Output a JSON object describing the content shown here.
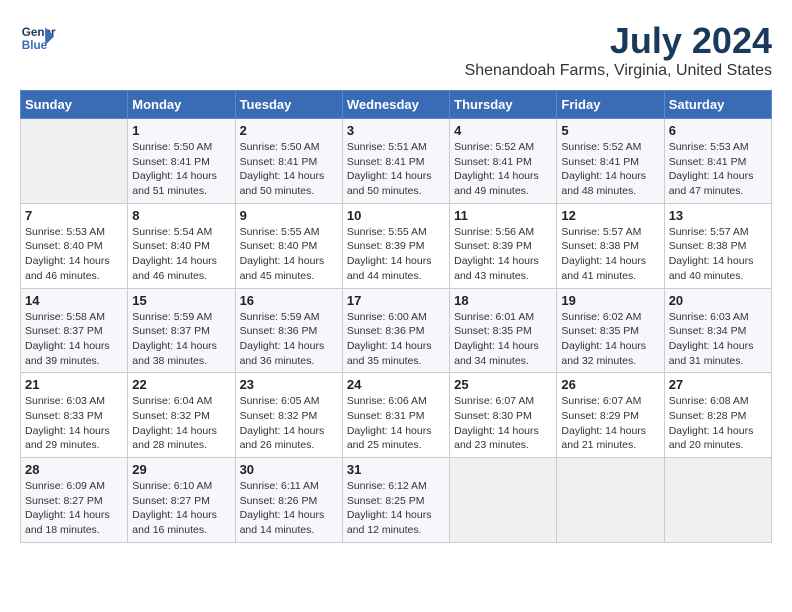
{
  "header": {
    "logo_line1": "General",
    "logo_line2": "Blue",
    "title": "July 2024",
    "subtitle": "Shenandoah Farms, Virginia, United States"
  },
  "weekdays": [
    "Sunday",
    "Monday",
    "Tuesday",
    "Wednesday",
    "Thursday",
    "Friday",
    "Saturday"
  ],
  "weeks": [
    [
      {
        "day": "",
        "info": ""
      },
      {
        "day": "1",
        "info": "Sunrise: 5:50 AM\nSunset: 8:41 PM\nDaylight: 14 hours\nand 51 minutes."
      },
      {
        "day": "2",
        "info": "Sunrise: 5:50 AM\nSunset: 8:41 PM\nDaylight: 14 hours\nand 50 minutes."
      },
      {
        "day": "3",
        "info": "Sunrise: 5:51 AM\nSunset: 8:41 PM\nDaylight: 14 hours\nand 50 minutes."
      },
      {
        "day": "4",
        "info": "Sunrise: 5:52 AM\nSunset: 8:41 PM\nDaylight: 14 hours\nand 49 minutes."
      },
      {
        "day": "5",
        "info": "Sunrise: 5:52 AM\nSunset: 8:41 PM\nDaylight: 14 hours\nand 48 minutes."
      },
      {
        "day": "6",
        "info": "Sunrise: 5:53 AM\nSunset: 8:41 PM\nDaylight: 14 hours\nand 47 minutes."
      }
    ],
    [
      {
        "day": "7",
        "info": "Sunrise: 5:53 AM\nSunset: 8:40 PM\nDaylight: 14 hours\nand 46 minutes."
      },
      {
        "day": "8",
        "info": "Sunrise: 5:54 AM\nSunset: 8:40 PM\nDaylight: 14 hours\nand 46 minutes."
      },
      {
        "day": "9",
        "info": "Sunrise: 5:55 AM\nSunset: 8:40 PM\nDaylight: 14 hours\nand 45 minutes."
      },
      {
        "day": "10",
        "info": "Sunrise: 5:55 AM\nSunset: 8:39 PM\nDaylight: 14 hours\nand 44 minutes."
      },
      {
        "day": "11",
        "info": "Sunrise: 5:56 AM\nSunset: 8:39 PM\nDaylight: 14 hours\nand 43 minutes."
      },
      {
        "day": "12",
        "info": "Sunrise: 5:57 AM\nSunset: 8:38 PM\nDaylight: 14 hours\nand 41 minutes."
      },
      {
        "day": "13",
        "info": "Sunrise: 5:57 AM\nSunset: 8:38 PM\nDaylight: 14 hours\nand 40 minutes."
      }
    ],
    [
      {
        "day": "14",
        "info": "Sunrise: 5:58 AM\nSunset: 8:37 PM\nDaylight: 14 hours\nand 39 minutes."
      },
      {
        "day": "15",
        "info": "Sunrise: 5:59 AM\nSunset: 8:37 PM\nDaylight: 14 hours\nand 38 minutes."
      },
      {
        "day": "16",
        "info": "Sunrise: 5:59 AM\nSunset: 8:36 PM\nDaylight: 14 hours\nand 36 minutes."
      },
      {
        "day": "17",
        "info": "Sunrise: 6:00 AM\nSunset: 8:36 PM\nDaylight: 14 hours\nand 35 minutes."
      },
      {
        "day": "18",
        "info": "Sunrise: 6:01 AM\nSunset: 8:35 PM\nDaylight: 14 hours\nand 34 minutes."
      },
      {
        "day": "19",
        "info": "Sunrise: 6:02 AM\nSunset: 8:35 PM\nDaylight: 14 hours\nand 32 minutes."
      },
      {
        "day": "20",
        "info": "Sunrise: 6:03 AM\nSunset: 8:34 PM\nDaylight: 14 hours\nand 31 minutes."
      }
    ],
    [
      {
        "day": "21",
        "info": "Sunrise: 6:03 AM\nSunset: 8:33 PM\nDaylight: 14 hours\nand 29 minutes."
      },
      {
        "day": "22",
        "info": "Sunrise: 6:04 AM\nSunset: 8:32 PM\nDaylight: 14 hours\nand 28 minutes."
      },
      {
        "day": "23",
        "info": "Sunrise: 6:05 AM\nSunset: 8:32 PM\nDaylight: 14 hours\nand 26 minutes."
      },
      {
        "day": "24",
        "info": "Sunrise: 6:06 AM\nSunset: 8:31 PM\nDaylight: 14 hours\nand 25 minutes."
      },
      {
        "day": "25",
        "info": "Sunrise: 6:07 AM\nSunset: 8:30 PM\nDaylight: 14 hours\nand 23 minutes."
      },
      {
        "day": "26",
        "info": "Sunrise: 6:07 AM\nSunset: 8:29 PM\nDaylight: 14 hours\nand 21 minutes."
      },
      {
        "day": "27",
        "info": "Sunrise: 6:08 AM\nSunset: 8:28 PM\nDaylight: 14 hours\nand 20 minutes."
      }
    ],
    [
      {
        "day": "28",
        "info": "Sunrise: 6:09 AM\nSunset: 8:27 PM\nDaylight: 14 hours\nand 18 minutes."
      },
      {
        "day": "29",
        "info": "Sunrise: 6:10 AM\nSunset: 8:27 PM\nDaylight: 14 hours\nand 16 minutes."
      },
      {
        "day": "30",
        "info": "Sunrise: 6:11 AM\nSunset: 8:26 PM\nDaylight: 14 hours\nand 14 minutes."
      },
      {
        "day": "31",
        "info": "Sunrise: 6:12 AM\nSunset: 8:25 PM\nDaylight: 14 hours\nand 12 minutes."
      },
      {
        "day": "",
        "info": ""
      },
      {
        "day": "",
        "info": ""
      },
      {
        "day": "",
        "info": ""
      }
    ]
  ]
}
